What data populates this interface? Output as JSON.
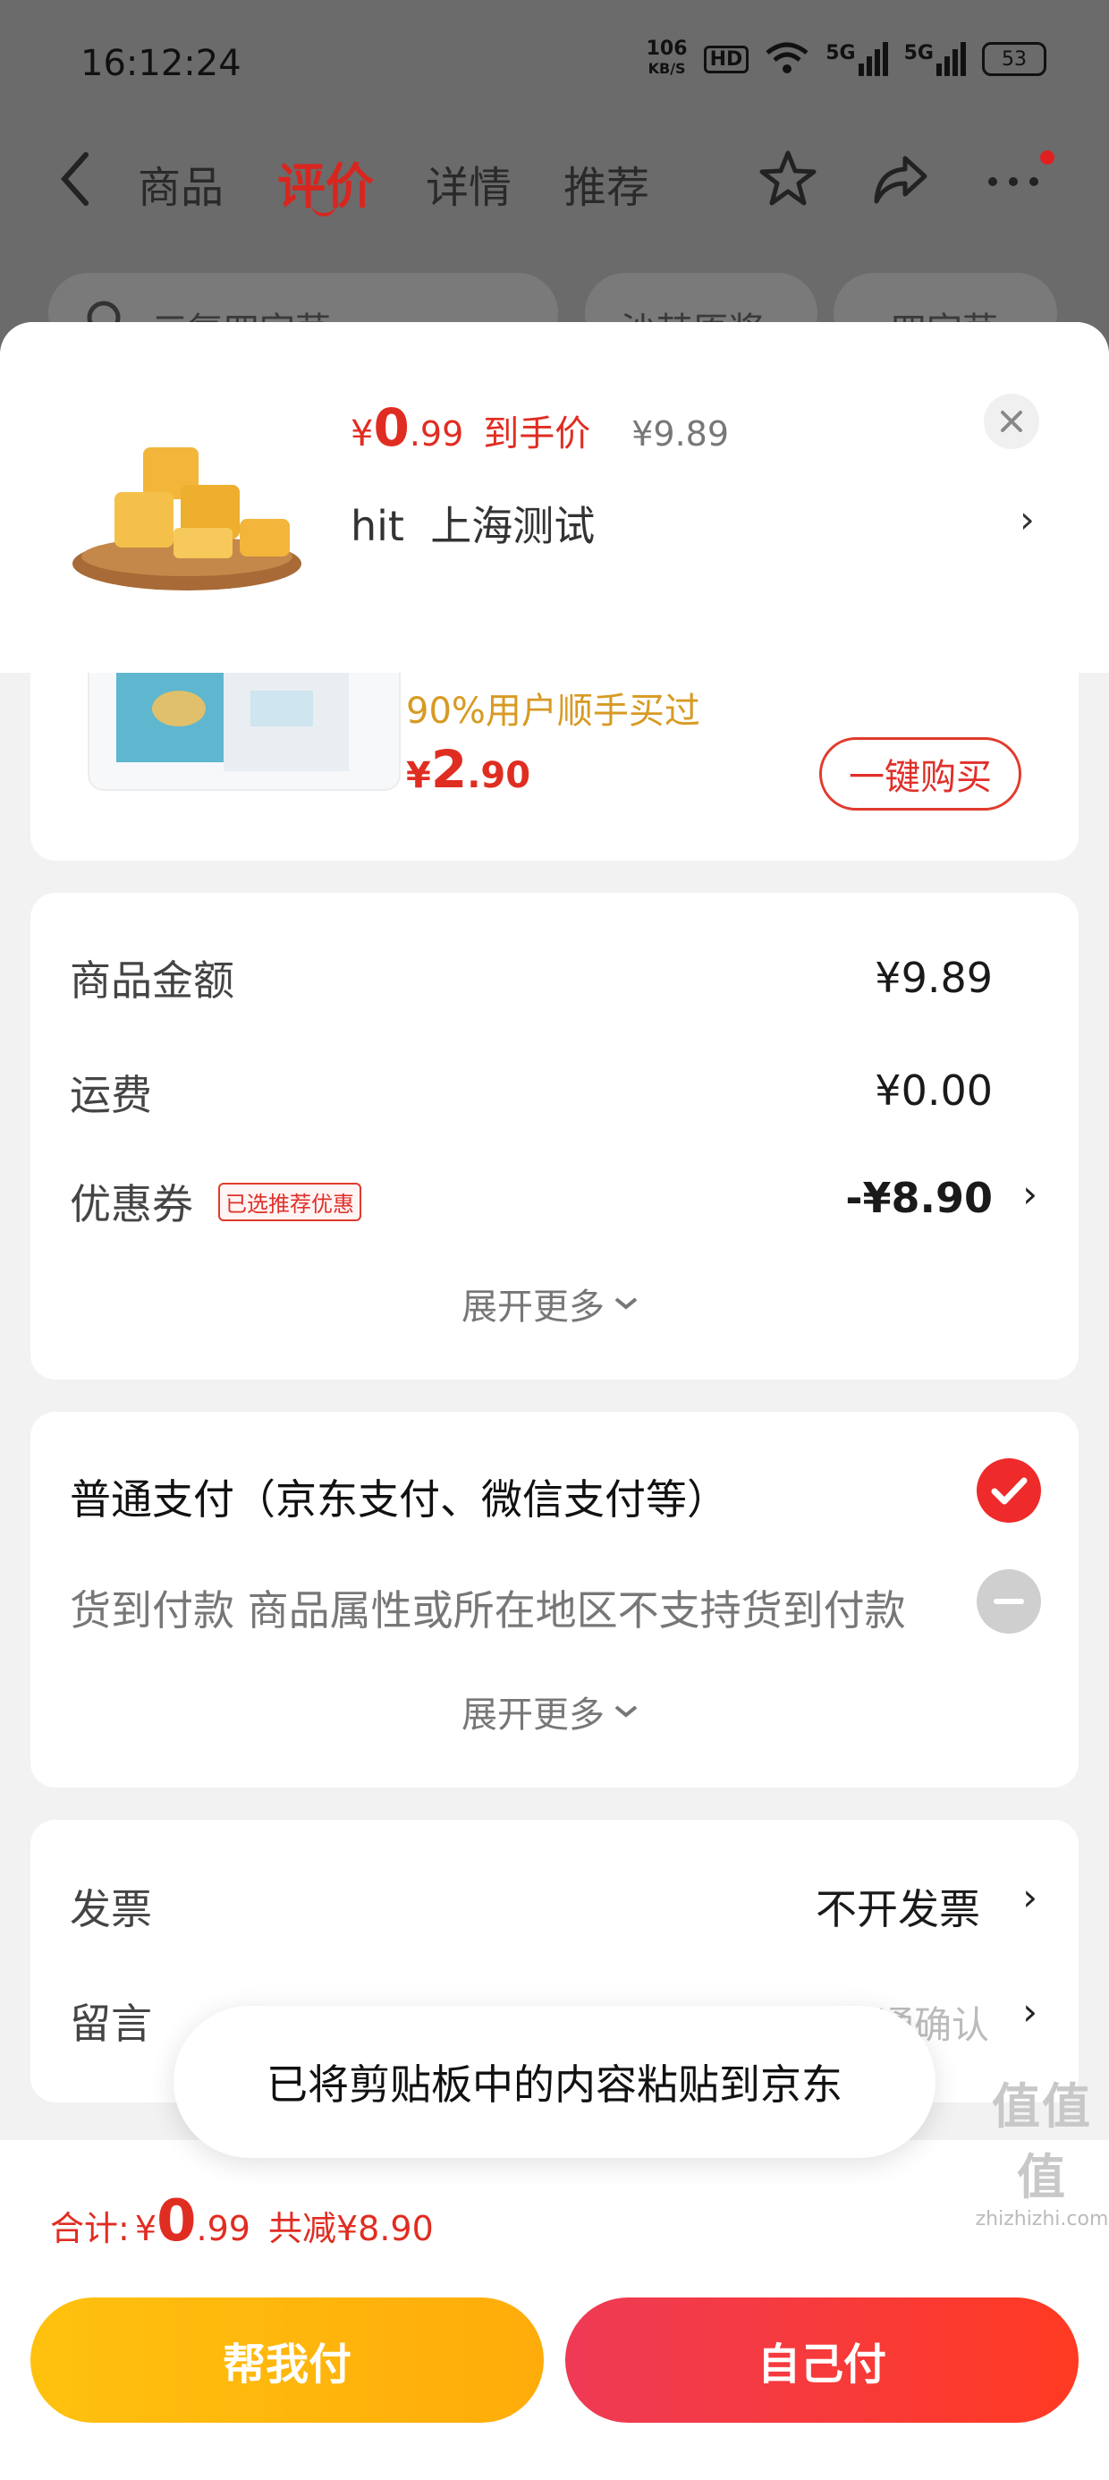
{
  "status": {
    "time": "16:12:24",
    "net_top": "106",
    "net_bottom": "KB/S",
    "hd": "HD",
    "sig1": "5G",
    "sig2": "5G",
    "battery": "53"
  },
  "nav": {
    "tabs": [
      "商品",
      "评价",
      "详情",
      "推荐"
    ],
    "active_tab": "评价"
  },
  "search_chips": [
    "三复四字茅",
    "沙棘原浆",
    "四字茅"
  ],
  "product": {
    "currency": "¥",
    "price_int": "0",
    "price_dec": ".99",
    "price_label": "到手价",
    "orig_price": "¥9.89",
    "spec": "hit  上海测试"
  },
  "recommend": {
    "note": "90%用户顺手买过",
    "currency": "¥",
    "price_int": "2",
    "price_dec": ".90",
    "buy_label": "一键购买"
  },
  "fees": {
    "goods_label": "商品金额",
    "goods_value": "¥9.89",
    "ship_label": "运费",
    "ship_value": "¥0.00",
    "coupon_label": "优惠券",
    "coupon_tag": "已选推荐优惠",
    "coupon_value": "-¥8.90",
    "more": "展开更多"
  },
  "payment": {
    "normal": "普通支付（京东支付、微信支付等）",
    "cod": "货到付款 商品属性或所在地区不支持货到付款",
    "more": "展开更多"
  },
  "extra": {
    "invoice_label": "发票",
    "invoice_value": "不开发票",
    "note_label": "留言",
    "note_placeholder": "建议留言前先与商家沟通确认"
  },
  "toast": "已将剪贴板中的内容粘贴到京东",
  "bottom": {
    "total_label": "合计:",
    "currency": "¥",
    "total_int": "0",
    "total_dec": ".99",
    "discount": "共减¥8.90",
    "help_pay": "帮我付",
    "self_pay": "自己付"
  },
  "watermark": {
    "logo": "值值值",
    "site": "zhizhizhi.com"
  },
  "colors": {
    "accent": "#e02d22",
    "gold": "#d79a23",
    "help_btn": "#ffb80c",
    "self_btn": "#f23434"
  }
}
